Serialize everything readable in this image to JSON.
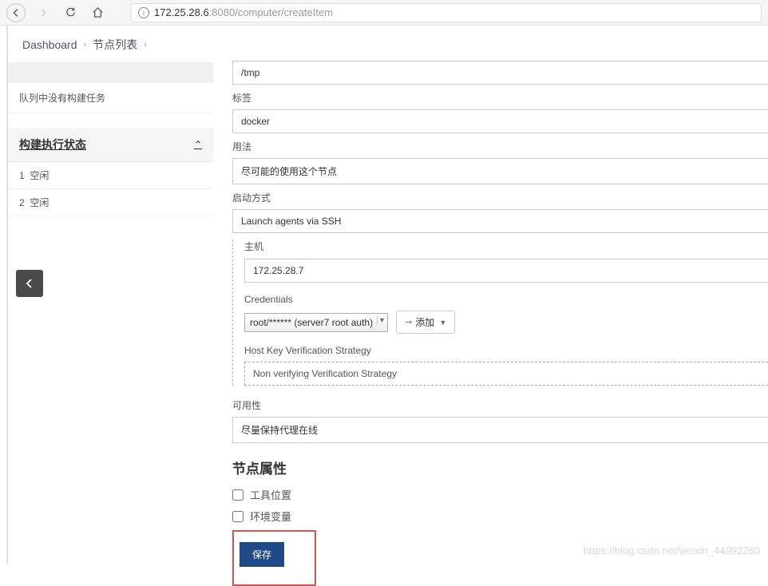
{
  "browser": {
    "url_host": "172.25.28.6",
    "url_path": ":8080/computer/createItem"
  },
  "breadcrumb": {
    "dashboard": "Dashboard",
    "nodes": "节点列表"
  },
  "sidebar": {
    "queue_empty": "队列中没有构建任务",
    "executor_header": "构建执行状态",
    "executors": [
      {
        "num": "1",
        "status": "空闲"
      },
      {
        "num": "2",
        "status": "空闲"
      }
    ]
  },
  "form": {
    "tmp_value": "/tmp",
    "label_label": "标签",
    "label_value": "docker",
    "usage_label": "用法",
    "usage_value": "尽可能的使用这个节点",
    "launch_label": "启动方式",
    "launch_value": "Launch agents via SSH",
    "host_label": "主机",
    "host_value": "172.25.28.7",
    "credentials_label": "Credentials",
    "credentials_value": "root/****** (server7 root auth)",
    "add_button": "添加",
    "hostkey_label": "Host Key Verification Strategy",
    "hostkey_value": "Non verifying Verification Strategy",
    "availability_label": "可用性",
    "availability_value": "尽量保持代理在线",
    "node_properties": "节点属性",
    "tool_locations": "工具位置",
    "env_vars": "环境变量",
    "save_button": "保存"
  },
  "watermark": "https://blog.csdn.net/weixin_44992260"
}
